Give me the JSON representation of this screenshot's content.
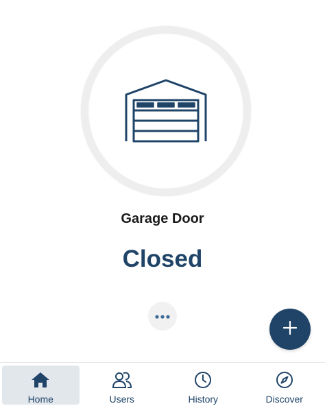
{
  "device": {
    "name": "Garage Door",
    "status": "Closed",
    "icon": "garage-door-icon"
  },
  "actions": {
    "more_icon": "more-dots-icon",
    "add_icon": "plus-icon"
  },
  "tabs": [
    {
      "label": "Home",
      "icon": "home-icon",
      "active": true
    },
    {
      "label": "Users",
      "icon": "users-icon",
      "active": false
    },
    {
      "label": "History",
      "icon": "clock-icon",
      "active": false
    },
    {
      "label": "Discover",
      "icon": "compass-icon",
      "active": false
    }
  ],
  "colors": {
    "accent": "#1f4468",
    "active_tab_bg": "#e2e7ec",
    "ring": "#eeeeee"
  }
}
